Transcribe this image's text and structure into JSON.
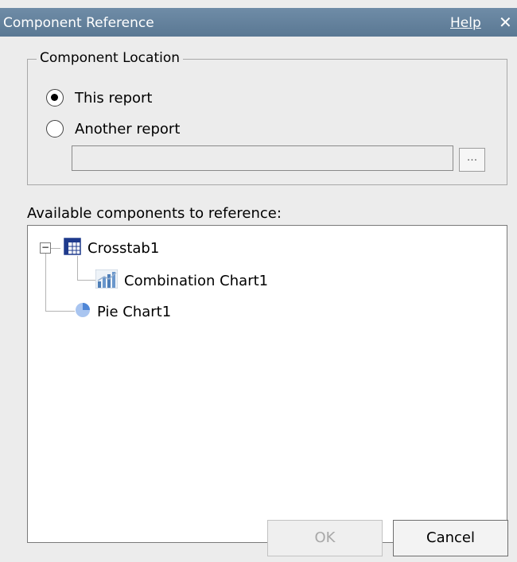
{
  "window": {
    "title": "Component Reference",
    "help_label": "Help",
    "close_glyph": "✕"
  },
  "location_group": {
    "legend": "Component Location",
    "options": [
      {
        "label": "This report",
        "selected": true
      },
      {
        "label": "Another report",
        "selected": false
      }
    ],
    "report_path_value": "",
    "browse_label": "..."
  },
  "components": {
    "label": "Available components to reference:",
    "tree": [
      {
        "label": "Crosstab1",
        "icon": "crosstab-icon",
        "expanded": true,
        "children": [
          {
            "label": "Combination Chart1",
            "icon": "combination-chart-icon"
          }
        ]
      },
      {
        "label": "Pie Chart1",
        "icon": "pie-chart-icon"
      }
    ]
  },
  "buttons": {
    "ok_label": "OK",
    "ok_enabled": false,
    "cancel_label": "Cancel"
  }
}
